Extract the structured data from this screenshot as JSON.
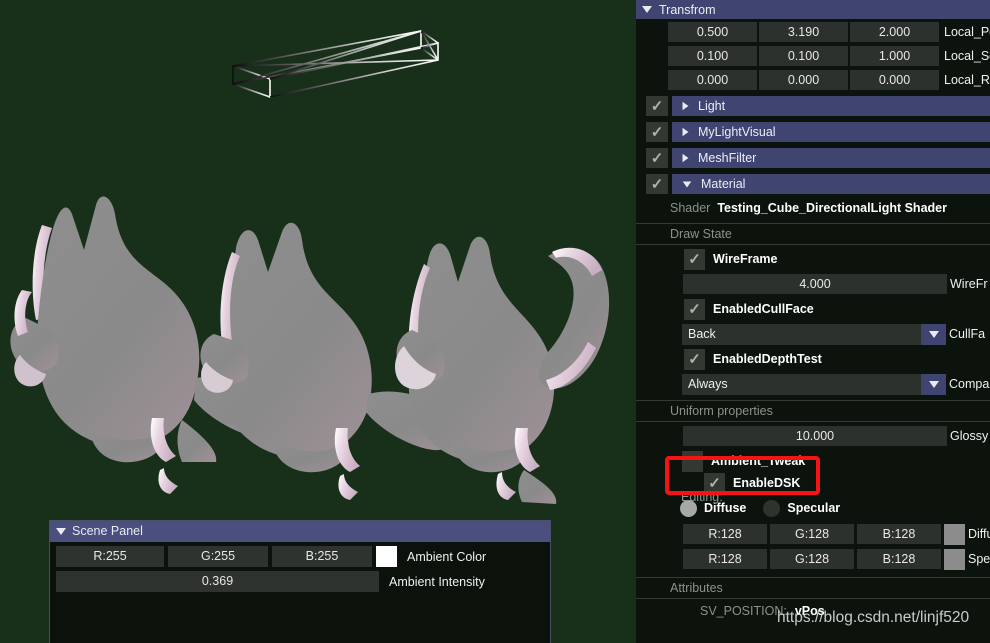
{
  "viewport": {
    "name": "scene-viewport",
    "background_color": "#18301a",
    "gizmo": "directional-light-wireframe-gizmo",
    "models": "three-gray-cat-meshes"
  },
  "scene_panel": {
    "title": "Scene Panel",
    "collapse_icon": "triangle-down-icon",
    "ambient_color": {
      "r": "R:255",
      "g": "G:255",
      "b": "B:255",
      "swatch": "#ffffff",
      "label": "Ambient Color"
    },
    "ambient_intensity": {
      "value": "0.369",
      "label": "Ambient Intensity"
    }
  },
  "inspector": {
    "transform": {
      "title": "Transfrom",
      "collapse_icon": "triangle-down-icon",
      "rows": [
        {
          "x": "0.500",
          "y": "3.190",
          "z": "2.000",
          "label": "Local_Pos"
        },
        {
          "x": "0.100",
          "y": "0.100",
          "z": "1.000",
          "label": "Local_Sca"
        },
        {
          "x": "0.000",
          "y": "0.000",
          "z": "0.000",
          "label": "Local_Rot"
        }
      ]
    },
    "components": [
      {
        "label": "Light",
        "enabled": true,
        "expanded": false
      },
      {
        "label": "MyLightVisual",
        "enabled": true,
        "expanded": false
      },
      {
        "label": "MeshFilter",
        "enabled": true,
        "expanded": false
      },
      {
        "label": "Material",
        "enabled": true,
        "expanded": true
      }
    ],
    "shader": {
      "label": "Shader",
      "value": "Testing_Cube_DirectionalLight Shader"
    },
    "draw_state": {
      "section_label": "Draw State",
      "wireframe": {
        "label": "WireFrame",
        "checked": true
      },
      "wireframe_width": {
        "value": "4.000",
        "label": "WireFr"
      },
      "enabled_cullface": {
        "label": "EnabledCullFace",
        "checked": true
      },
      "cullface": {
        "value": "Back",
        "label": "CullFa",
        "arrow_icon": "triangle-down-icon"
      },
      "enabled_depthtest": {
        "label": "EnabledDepthTest",
        "checked": true
      },
      "compare": {
        "value": "Always",
        "label": "Compa",
        "arrow_icon": "triangle-down-icon"
      }
    },
    "uniform_properties": {
      "section_label": "Uniform properties",
      "glossy": {
        "value": "10.000",
        "label": "Glossy"
      },
      "ambient_tweak": {
        "label": "Ambient_Tweak",
        "checked": false
      },
      "editing_label": "Editing:",
      "enable_dsk": {
        "label": "EnableDSK",
        "checked": true
      },
      "radios": [
        {
          "label": "Diffuse",
          "selected": true
        },
        {
          "label": "Specular",
          "selected": false
        }
      ],
      "diffuse_color": {
        "r": "R:128",
        "g": "G:128",
        "b": "B:128",
        "swatch": "#8c8c8c",
        "label": "Diffuse"
      },
      "specular_color": {
        "r": "R:128",
        "g": "G:128",
        "b": "B:128",
        "swatch": "#8c8c8c",
        "label": "Specu"
      }
    },
    "attributes": {
      "section_label": "Attributes",
      "rows": [
        {
          "key": "SV_POSITION:",
          "value": "vPos"
        }
      ]
    }
  },
  "annotation": {
    "highlight_color": "#f51414",
    "highlight_target": "Ambient_Tweak"
  },
  "watermark": {
    "text": "https://blog.csdn.net/linjf520"
  }
}
